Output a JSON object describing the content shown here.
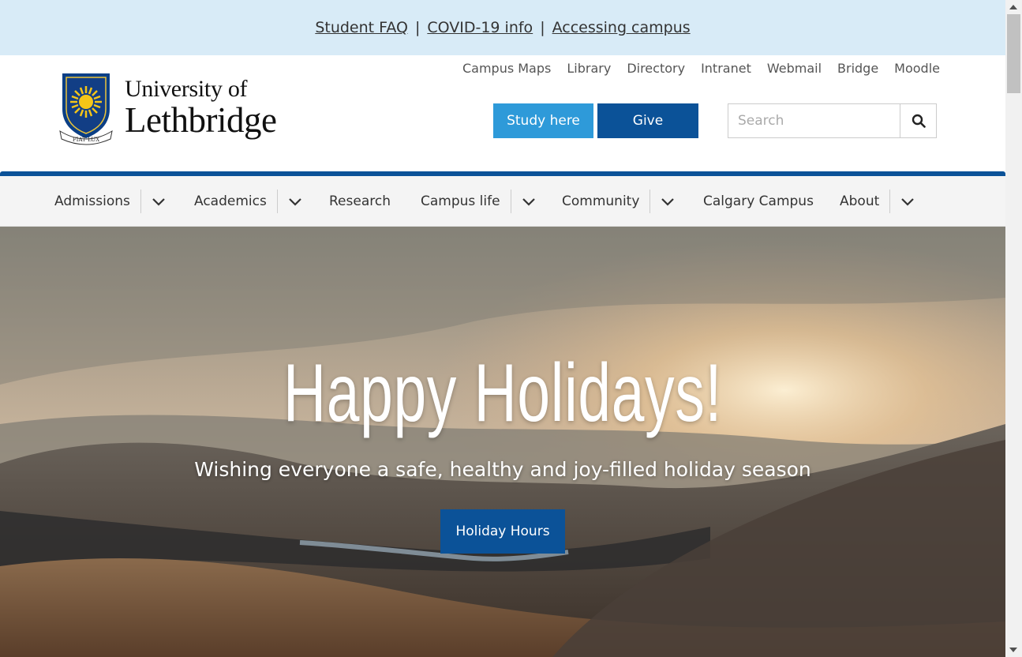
{
  "alert_bar": {
    "links": [
      "Student FAQ",
      "COVID-19 info",
      "Accessing campus"
    ],
    "separator": "|"
  },
  "logo": {
    "line1": "University of",
    "line2": "Lethbridge",
    "motto": "FIAT LUX"
  },
  "utility_links": [
    "Campus Maps",
    "Library",
    "Directory",
    "Intranet",
    "Webmail",
    "Bridge",
    "Moodle"
  ],
  "buttons": {
    "study": "Study here",
    "give": "Give"
  },
  "search": {
    "placeholder": "Search"
  },
  "nav": {
    "items": [
      {
        "label": "Admissions",
        "has_dropdown": true
      },
      {
        "label": "Academics",
        "has_dropdown": true
      },
      {
        "label": "Research",
        "has_dropdown": false
      },
      {
        "label": "Campus life",
        "has_dropdown": true
      },
      {
        "label": "Community",
        "has_dropdown": true
      },
      {
        "label": "Calgary Campus",
        "has_dropdown": false
      },
      {
        "label": "About",
        "has_dropdown": true
      }
    ]
  },
  "hero": {
    "title": "Happy Holidays!",
    "subtitle": "Wishing everyone a safe, healthy and joy-filled holiday season",
    "button": "Holiday Hours"
  },
  "colors": {
    "alert_bg": "#d8ebf7",
    "primary_blue": "#0b5298",
    "study_blue": "#2e9ad9",
    "nav_bg": "#f4f4f4"
  }
}
